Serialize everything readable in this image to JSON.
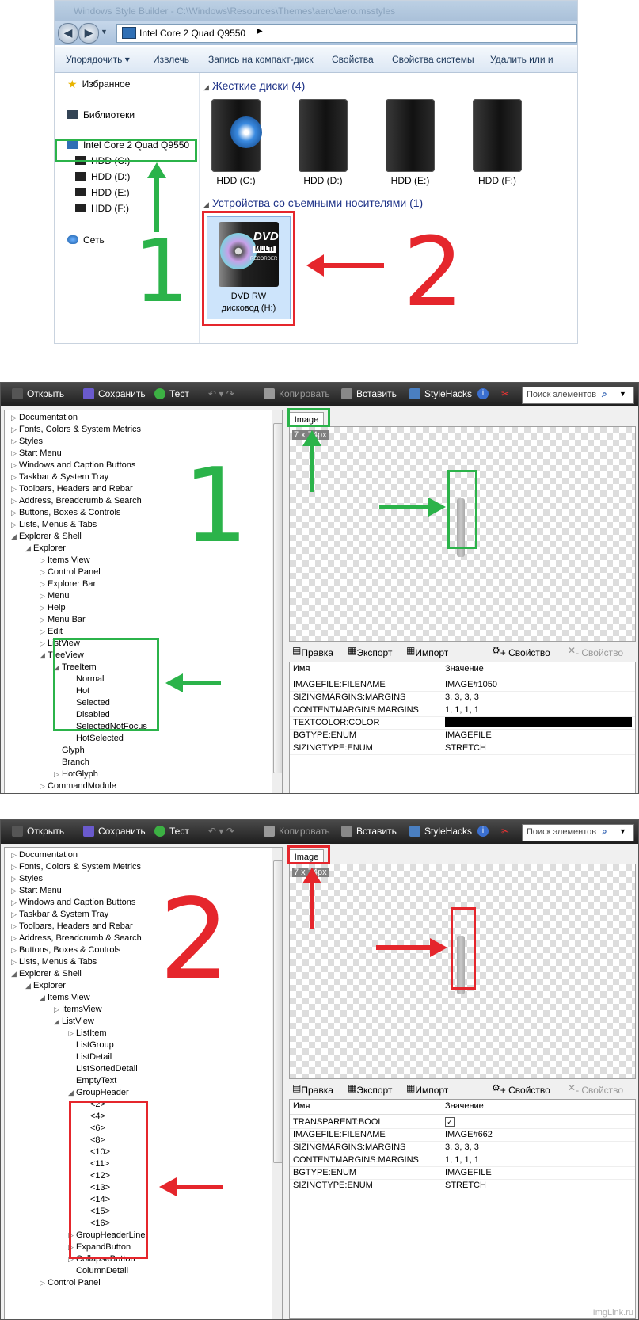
{
  "explorer": {
    "title": "Windows Style Builder - C:\\Windows\\Resources\\Themes\\aero\\aero.msstyles",
    "address": "Intel Core 2 Quad Q9550",
    "toolbar": [
      "Упорядочить ▾",
      "Извлечь",
      "Запись на компакт-диск",
      "Свойства",
      "Свойства системы",
      "Удалить или и"
    ],
    "nav": {
      "favorites": "Избранное",
      "libraries": "Библиотеки",
      "computer": "Intel Core 2 Quad Q9550",
      "drives": [
        "HDD (C:)",
        "HDD (D:)",
        "HDD (E:)",
        "HDD (F:)"
      ],
      "network": "Сеть"
    },
    "hard_disks_group": "Жесткие диски (4)",
    "drives": [
      "HDD (C:)",
      "HDD (D:)",
      "HDD (E:)",
      "HDD (F:)"
    ],
    "removable_group": "Устройства со съемными носителями (1)",
    "dvd": {
      "line1": "DVD RW",
      "line2": "дисковод (H:)",
      "logo1": "DVD",
      "logo2": "MULTI",
      "logo3": "RECORDER"
    },
    "annot1": "1",
    "annot2": "2"
  },
  "sb_toolbar": {
    "open": "Открыть",
    "save": "Сохранить",
    "test": "Тест",
    "copy": "Копировать",
    "paste": "Вставить",
    "stylehacks": "StyleHacks",
    "search_placeholder": "Поиск элементов"
  },
  "prop_toolbar": {
    "edit": "Правка",
    "export": "Экспорт",
    "import": "Импорт",
    "add_prop": "+ Свойство",
    "del_prop": "- Свойство"
  },
  "grid_head": {
    "name": "Имя",
    "value": "Значение"
  },
  "image_tab": "Image",
  "panel1": {
    "dim": "7 x 74px",
    "annot": "1",
    "tree": [
      {
        "t": "Documentation",
        "l": 0,
        "a": "▷"
      },
      {
        "t": "Fonts, Colors & System Metrics",
        "l": 0,
        "a": "▷"
      },
      {
        "t": "Styles",
        "l": 0,
        "a": "▷"
      },
      {
        "t": "Start Menu",
        "l": 0,
        "a": "▷"
      },
      {
        "t": "Windows and Caption Buttons",
        "l": 0,
        "a": "▷"
      },
      {
        "t": "Taskbar & System Tray",
        "l": 0,
        "a": "▷"
      },
      {
        "t": "Toolbars, Headers and Rebar",
        "l": 0,
        "a": "▷"
      },
      {
        "t": "Address, Breadcrumb & Search",
        "l": 0,
        "a": "▷"
      },
      {
        "t": "Buttons, Boxes & Controls",
        "l": 0,
        "a": "▷"
      },
      {
        "t": "Lists, Menus & Tabs",
        "l": 0,
        "a": "▷"
      },
      {
        "t": "Explorer & Shell",
        "l": 0,
        "a": "◢"
      },
      {
        "t": "Explorer",
        "l": 1,
        "a": "◢"
      },
      {
        "t": "Items View",
        "l": 2,
        "a": "▷"
      },
      {
        "t": "Control Panel",
        "l": 2,
        "a": "▷"
      },
      {
        "t": "Explorer Bar",
        "l": 2,
        "a": "▷"
      },
      {
        "t": "Menu",
        "l": 2,
        "a": "▷"
      },
      {
        "t": "Help",
        "l": 2,
        "a": "▷"
      },
      {
        "t": "Menu Bar",
        "l": 2,
        "a": "▷"
      },
      {
        "t": "Edit",
        "l": 2,
        "a": "▷"
      },
      {
        "t": "ListView",
        "l": 2,
        "a": "▷"
      },
      {
        "t": "TreeView",
        "l": 2,
        "a": "◢"
      },
      {
        "t": "TreeItem",
        "l": 3,
        "a": "◢"
      },
      {
        "t": "Normal",
        "l": 4,
        "a": ""
      },
      {
        "t": "Hot",
        "l": 4,
        "a": ""
      },
      {
        "t": "Selected",
        "l": 4,
        "a": ""
      },
      {
        "t": "Disabled",
        "l": 4,
        "a": ""
      },
      {
        "t": "SelectedNotFocus",
        "l": 4,
        "a": ""
      },
      {
        "t": "HotSelected",
        "l": 4,
        "a": ""
      },
      {
        "t": "Glyph",
        "l": 3,
        "a": ""
      },
      {
        "t": "Branch",
        "l": 3,
        "a": ""
      },
      {
        "t": "HotGlyph",
        "l": 3,
        "a": "▷"
      },
      {
        "t": "CommandModule",
        "l": 2,
        "a": "▷"
      }
    ],
    "props": [
      {
        "n": "IMAGEFILE:FILENAME",
        "v": "IMAGE#1050"
      },
      {
        "n": "SIZINGMARGINS:MARGINS",
        "v": "3, 3, 3, 3"
      },
      {
        "n": "CONTENTMARGINS:MARGINS",
        "v": "1, 1, 1, 1"
      },
      {
        "n": "TEXTCOLOR:COLOR",
        "v": ""
      },
      {
        "n": "BGTYPE:ENUM",
        "v": "IMAGEFILE"
      },
      {
        "n": "SIZINGTYPE:ENUM",
        "v": "STRETCH"
      }
    ]
  },
  "panel2": {
    "dim": "7 x 74px",
    "annot": "2",
    "tree": [
      {
        "t": "Documentation",
        "l": 0,
        "a": "▷"
      },
      {
        "t": "Fonts, Colors & System Metrics",
        "l": 0,
        "a": "▷"
      },
      {
        "t": "Styles",
        "l": 0,
        "a": "▷"
      },
      {
        "t": "Start Menu",
        "l": 0,
        "a": "▷"
      },
      {
        "t": "Windows and Caption Buttons",
        "l": 0,
        "a": "▷"
      },
      {
        "t": "Taskbar & System Tray",
        "l": 0,
        "a": "▷"
      },
      {
        "t": "Toolbars, Headers and Rebar",
        "l": 0,
        "a": "▷"
      },
      {
        "t": "Address, Breadcrumb & Search",
        "l": 0,
        "a": "▷"
      },
      {
        "t": "Buttons, Boxes & Controls",
        "l": 0,
        "a": "▷"
      },
      {
        "t": "Lists, Menus & Tabs",
        "l": 0,
        "a": "▷"
      },
      {
        "t": "Explorer & Shell",
        "l": 0,
        "a": "◢"
      },
      {
        "t": "Explorer",
        "l": 1,
        "a": "◢"
      },
      {
        "t": "Items View",
        "l": 2,
        "a": "◢"
      },
      {
        "t": "ItemsView",
        "l": 3,
        "a": "▷"
      },
      {
        "t": "ListView",
        "l": 3,
        "a": "◢"
      },
      {
        "t": "ListItem",
        "l": 4,
        "a": "▷"
      },
      {
        "t": "ListGroup",
        "l": 4,
        "a": ""
      },
      {
        "t": "ListDetail",
        "l": 4,
        "a": ""
      },
      {
        "t": "ListSortedDetail",
        "l": 4,
        "a": ""
      },
      {
        "t": "EmptyText",
        "l": 4,
        "a": ""
      },
      {
        "t": "GroupHeader",
        "l": 4,
        "a": "◢"
      },
      {
        "t": "<2>",
        "l": 5,
        "a": ""
      },
      {
        "t": "<4>",
        "l": 5,
        "a": ""
      },
      {
        "t": "<6>",
        "l": 5,
        "a": ""
      },
      {
        "t": "<8>",
        "l": 5,
        "a": ""
      },
      {
        "t": "<10>",
        "l": 5,
        "a": ""
      },
      {
        "t": "<11>",
        "l": 5,
        "a": ""
      },
      {
        "t": "<12>",
        "l": 5,
        "a": ""
      },
      {
        "t": "<13>",
        "l": 5,
        "a": ""
      },
      {
        "t": "<14>",
        "l": 5,
        "a": ""
      },
      {
        "t": "<15>",
        "l": 5,
        "a": ""
      },
      {
        "t": "<16>",
        "l": 5,
        "a": ""
      },
      {
        "t": "GroupHeaderLine",
        "l": 4,
        "a": "▷"
      },
      {
        "t": "ExpandButton",
        "l": 4,
        "a": "▷"
      },
      {
        "t": "CollapseButton",
        "l": 4,
        "a": "▷"
      },
      {
        "t": "ColumnDetail",
        "l": 4,
        "a": ""
      },
      {
        "t": "Control Panel",
        "l": 2,
        "a": "▷"
      }
    ],
    "props": [
      {
        "n": "TRANSPARENT:BOOL",
        "v": "✓"
      },
      {
        "n": "IMAGEFILE:FILENAME",
        "v": "IMAGE#662"
      },
      {
        "n": "SIZINGMARGINS:MARGINS",
        "v": "3, 3, 3, 3"
      },
      {
        "n": "CONTENTMARGINS:MARGINS",
        "v": "1, 1, 1, 1"
      },
      {
        "n": "BGTYPE:ENUM",
        "v": "IMAGEFILE"
      },
      {
        "n": "SIZINGTYPE:ENUM",
        "v": "STRETCH"
      }
    ]
  },
  "watermark": "ImgLink.ru",
  "colors": {
    "green": "#2bb34a",
    "red": "#e5262c"
  }
}
